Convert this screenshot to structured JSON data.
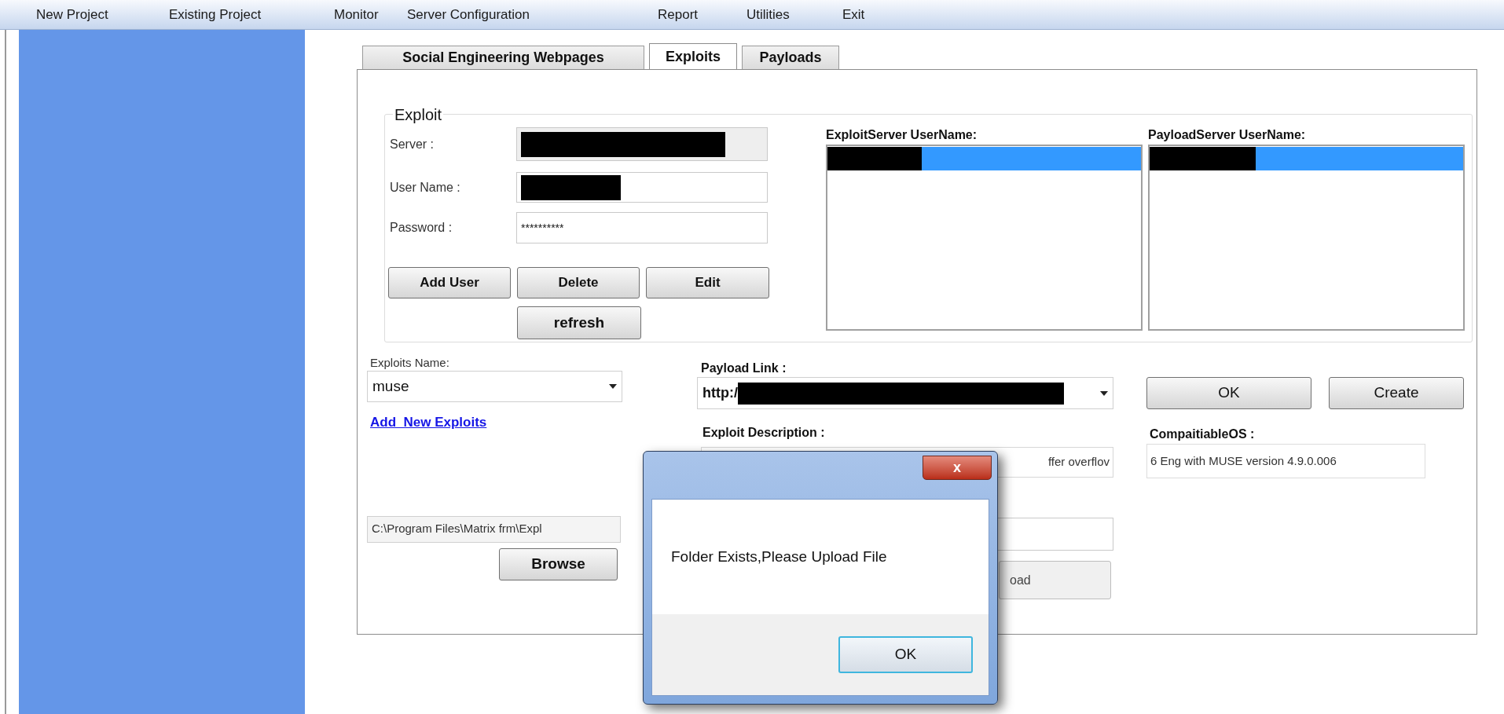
{
  "menu": [
    {
      "label": "New Project"
    },
    {
      "label": "Existing Project"
    },
    {
      "label": "Monitor"
    },
    {
      "label": "Server Configuration"
    },
    {
      "label": "Report"
    },
    {
      "label": "Utilities"
    },
    {
      "label": "Exit"
    }
  ],
  "tabs": [
    {
      "label": "Social Engineering Webpages",
      "selected": false
    },
    {
      "label": "Exploits",
      "selected": true
    },
    {
      "label": "Payloads",
      "selected": false
    }
  ],
  "exploit_group": {
    "title": "Exploit",
    "fields": [
      {
        "label": "Server :",
        "redacted": true,
        "disabled": true
      },
      {
        "label": "User Name :",
        "redacted": true,
        "disabled": false
      },
      {
        "label": "Password :",
        "value": "**********",
        "disabled": false
      }
    ],
    "buttons": [
      "Add User",
      "Delete",
      "Edit"
    ],
    "refresh_button": "refresh"
  },
  "lists": [
    {
      "title": "ExploitServer UserName:",
      "items": [
        {
          "redacted": true,
          "selected": true
        }
      ]
    },
    {
      "title": "PayloadServer UserName:",
      "items": [
        {
          "redacted": true,
          "selected": true
        }
      ]
    }
  ],
  "exploits_name": {
    "label": "Exploits Name:",
    "value": "muse"
  },
  "add_link": "Add  New Exploits",
  "file_path": "C:\\Program Files\\Matrix frm\\Expl",
  "browse_button": "Browse",
  "payload_link": {
    "label": "Payload Link :",
    "value": "http:/",
    "redacted": true
  },
  "exploit_description": {
    "label": "Exploit Description :",
    "value": "ffer overflov"
  },
  "upload_button": "oad",
  "ok_button": "OK",
  "create_button": "Create",
  "compatible_os": {
    "label": "CompaitiableOS :",
    "value": "6 Eng with MUSE version 4.9.0.006"
  },
  "dialog": {
    "close": "x",
    "message": "Folder Exists,Please Upload File",
    "button": "OK"
  }
}
